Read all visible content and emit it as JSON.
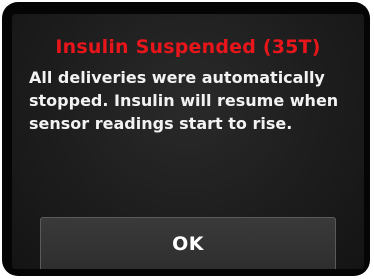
{
  "alert": {
    "title": "Insulin Suspended (35T)",
    "message": "All deliveries were automatically stopped. Insulin will resume when sensor readings start to rise.",
    "ok_label": "OK"
  },
  "colors": {
    "title": "#e8151b",
    "text": "#f2f2f2",
    "screen_bg": "#1d1d1d",
    "button_bg": "#333333"
  }
}
